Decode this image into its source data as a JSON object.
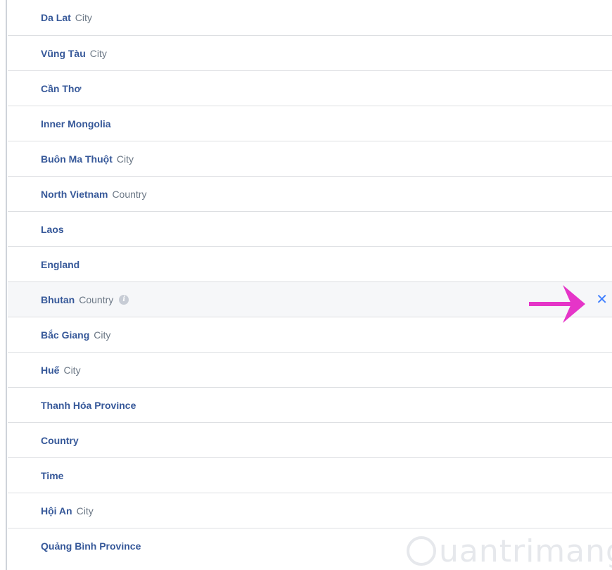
{
  "items": [
    {
      "name": "Da Lat",
      "type": "City"
    },
    {
      "name": "Vũng Tàu",
      "type": "City"
    },
    {
      "name": "Cần Thơ",
      "type": ""
    },
    {
      "name": "Inner Mongolia",
      "type": ""
    },
    {
      "name": "Buôn Ma Thuột",
      "type": "City"
    },
    {
      "name": "North Vietnam",
      "type": "Country"
    },
    {
      "name": "Laos",
      "type": ""
    },
    {
      "name": "England",
      "type": ""
    },
    {
      "name": "Bhutan",
      "type": "Country"
    },
    {
      "name": "Bắc Giang",
      "type": "City"
    },
    {
      "name": "Huế",
      "type": "City"
    },
    {
      "name": "Thanh Hóa Province",
      "type": ""
    },
    {
      "name": "Country",
      "type": ""
    },
    {
      "name": "Time",
      "type": ""
    },
    {
      "name": "Hội An",
      "type": "City"
    },
    {
      "name": "Quảng Bình Province",
      "type": ""
    }
  ],
  "remove_symbol": "✕",
  "info_symbol": "i",
  "colors": {
    "name": "#365899",
    "type": "#6b7785",
    "remove": "#4080ff",
    "arrow": "#e535c8",
    "highlight_bg": "#f6f7f9"
  },
  "watermark": {
    "text": "uantrimang"
  }
}
